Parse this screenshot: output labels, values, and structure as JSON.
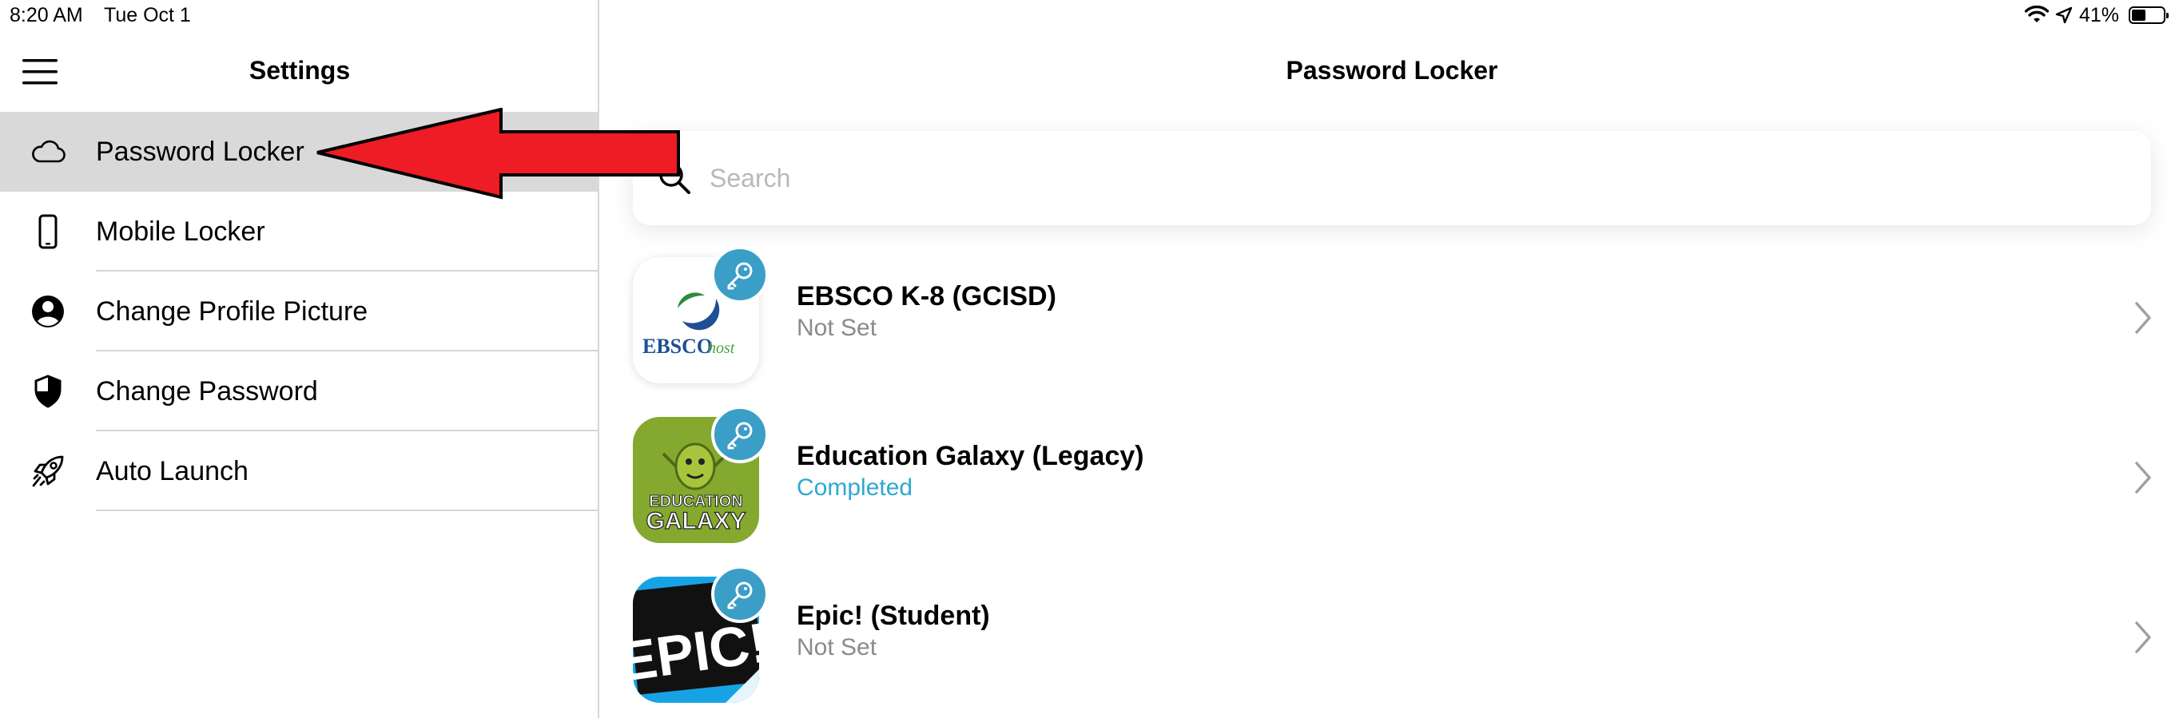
{
  "status": {
    "time": "8:20 AM",
    "date": "Tue Oct 1",
    "battery_percent": "41%",
    "battery_level": 0.41,
    "icons": [
      "wifi-icon",
      "location-icon",
      "battery-icon"
    ]
  },
  "sidebar": {
    "title": "Settings",
    "items": [
      {
        "label": "Password Locker",
        "icon": "cloud-icon",
        "selected": true
      },
      {
        "label": "Mobile Locker",
        "icon": "phone-icon",
        "selected": false
      },
      {
        "label": "Change Profile Picture",
        "icon": "user-circle-icon",
        "selected": false
      },
      {
        "label": "Change Password",
        "icon": "shield-icon",
        "selected": false
      },
      {
        "label": "Auto Launch",
        "icon": "rocket-icon",
        "selected": false
      }
    ]
  },
  "main": {
    "title": "Password Locker",
    "search": {
      "placeholder": "Search",
      "value": ""
    },
    "apps": [
      {
        "name": "EBSCO K-8 (GCISD)",
        "status": "Not Set",
        "status_color": "#8a8a8e",
        "logo_text": "EBSCO",
        "logo_text_2": "host"
      },
      {
        "name": "Education Galaxy (Legacy)",
        "status": "Completed",
        "status_color": "#2ea8d1",
        "logo_text": "EDUCATION",
        "logo_text_2": "GALAXY"
      },
      {
        "name": "Epic! (Student)",
        "status": "Not Set",
        "status_color": "#8a8a8e",
        "logo_text": "EPIC!"
      }
    ]
  },
  "colors": {
    "selected_row": "#d9d9d9",
    "key_badge": "#3b9ec6",
    "annotation_arrow": "#ee1c24"
  }
}
